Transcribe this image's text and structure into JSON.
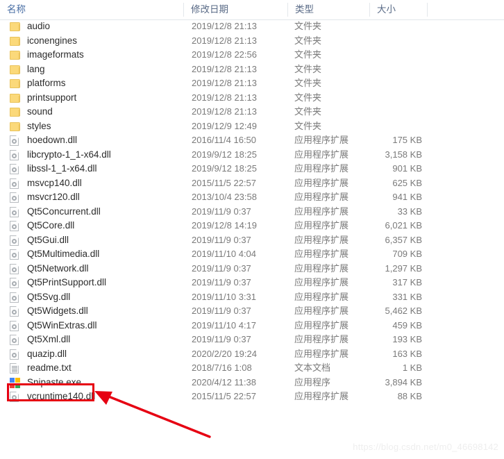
{
  "window": {
    "title": "File Explorer listing"
  },
  "columns": [
    {
      "key": "name",
      "label": "名称",
      "icon": "sort-ascending-icon",
      "sorted": true
    },
    {
      "key": "date",
      "label": "修改日期",
      "sorted": false
    },
    {
      "key": "type",
      "label": "类型",
      "sorted": false
    },
    {
      "key": "size",
      "label": "大小",
      "sorted": false
    }
  ],
  "types": {
    "folder": "文件夹",
    "app_extension": "应用程序扩展",
    "text_document": "文本文档",
    "application": "应用程序"
  },
  "rows": [
    {
      "name": "audio",
      "date": "2019/12/8 21:13",
      "type": "文件夹",
      "size": "",
      "icon": "folder-icon"
    },
    {
      "name": "iconengines",
      "date": "2019/12/8 21:13",
      "type": "文件夹",
      "size": "",
      "icon": "folder-icon"
    },
    {
      "name": "imageformats",
      "date": "2019/12/8 22:56",
      "type": "文件夹",
      "size": "",
      "icon": "folder-icon"
    },
    {
      "name": "lang",
      "date": "2019/12/8 21:13",
      "type": "文件夹",
      "size": "",
      "icon": "folder-icon"
    },
    {
      "name": "platforms",
      "date": "2019/12/8 21:13",
      "type": "文件夹",
      "size": "",
      "icon": "folder-icon"
    },
    {
      "name": "printsupport",
      "date": "2019/12/8 21:13",
      "type": "文件夹",
      "size": "",
      "icon": "folder-icon"
    },
    {
      "name": "sound",
      "date": "2019/12/8 21:13",
      "type": "文件夹",
      "size": "",
      "icon": "folder-icon"
    },
    {
      "name": "styles",
      "date": "2019/12/9 12:49",
      "type": "文件夹",
      "size": "",
      "icon": "folder-icon"
    },
    {
      "name": "hoedown.dll",
      "date": "2016/11/4 16:50",
      "type": "应用程序扩展",
      "size": "175 KB",
      "icon": "dll-file-icon"
    },
    {
      "name": "libcrypto-1_1-x64.dll",
      "date": "2019/9/12 18:25",
      "type": "应用程序扩展",
      "size": "3,158 KB",
      "icon": "dll-file-icon"
    },
    {
      "name": "libssl-1_1-x64.dll",
      "date": "2019/9/12 18:25",
      "type": "应用程序扩展",
      "size": "901 KB",
      "icon": "dll-file-icon"
    },
    {
      "name": "msvcp140.dll",
      "date": "2015/11/5 22:57",
      "type": "应用程序扩展",
      "size": "625 KB",
      "icon": "dll-file-icon"
    },
    {
      "name": "msvcr120.dll",
      "date": "2013/10/4 23:58",
      "type": "应用程序扩展",
      "size": "941 KB",
      "icon": "dll-file-icon"
    },
    {
      "name": "Qt5Concurrent.dll",
      "date": "2019/11/9 0:37",
      "type": "应用程序扩展",
      "size": "33 KB",
      "icon": "dll-file-icon"
    },
    {
      "name": "Qt5Core.dll",
      "date": "2019/12/8 14:19",
      "type": "应用程序扩展",
      "size": "6,021 KB",
      "icon": "dll-file-icon"
    },
    {
      "name": "Qt5Gui.dll",
      "date": "2019/11/9 0:37",
      "type": "应用程序扩展",
      "size": "6,357 KB",
      "icon": "dll-file-icon"
    },
    {
      "name": "Qt5Multimedia.dll",
      "date": "2019/11/10 4:04",
      "type": "应用程序扩展",
      "size": "709 KB",
      "icon": "dll-file-icon"
    },
    {
      "name": "Qt5Network.dll",
      "date": "2019/11/9 0:37",
      "type": "应用程序扩展",
      "size": "1,297 KB",
      "icon": "dll-file-icon"
    },
    {
      "name": "Qt5PrintSupport.dll",
      "date": "2019/11/9 0:37",
      "type": "应用程序扩展",
      "size": "317 KB",
      "icon": "dll-file-icon"
    },
    {
      "name": "Qt5Svg.dll",
      "date": "2019/11/10 3:31",
      "type": "应用程序扩展",
      "size": "331 KB",
      "icon": "dll-file-icon"
    },
    {
      "name": "Qt5Widgets.dll",
      "date": "2019/11/9 0:37",
      "type": "应用程序扩展",
      "size": "5,462 KB",
      "icon": "dll-file-icon"
    },
    {
      "name": "Qt5WinExtras.dll",
      "date": "2019/11/10 4:17",
      "type": "应用程序扩展",
      "size": "459 KB",
      "icon": "dll-file-icon"
    },
    {
      "name": "Qt5Xml.dll",
      "date": "2019/11/9 0:37",
      "type": "应用程序扩展",
      "size": "193 KB",
      "icon": "dll-file-icon"
    },
    {
      "name": "quazip.dll",
      "date": "2020/2/20 19:24",
      "type": "应用程序扩展",
      "size": "163 KB",
      "icon": "dll-file-icon"
    },
    {
      "name": "readme.txt",
      "date": "2018/7/16 1:08",
      "type": "文本文档",
      "size": "1 KB",
      "icon": "text-file-icon"
    },
    {
      "name": "Snipaste.exe",
      "date": "2020/4/12 11:38",
      "type": "应用程序",
      "size": "3,894 KB",
      "icon": "snipaste-app-icon",
      "highlighted": true
    },
    {
      "name": "vcruntime140.dll",
      "date": "2015/11/5 22:57",
      "type": "应用程序扩展",
      "size": "88 KB",
      "icon": "dll-file-icon"
    }
  ],
  "annotation": {
    "highlight_target": "Snipaste.exe",
    "highlight_color": "#e60012",
    "arrow_color": "#e60012"
  },
  "watermark": {
    "text": "https://blog.csdn.net/m0_46698142"
  },
  "icon_colors": {
    "snipaste_blue": "#4285f4",
    "snipaste_yellow": "#fbbc05",
    "snipaste_red": "#ea4335",
    "snipaste_green": "#34a853",
    "folder": "#fbd97a"
  }
}
